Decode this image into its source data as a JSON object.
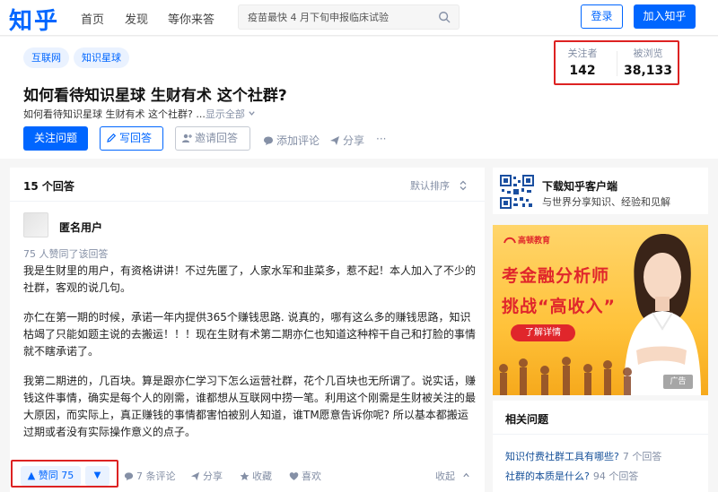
{
  "brand": {
    "logo_text": "知乎"
  },
  "nav": {
    "links": [
      "首页",
      "发现",
      "等你来答"
    ]
  },
  "search": {
    "placeholder": "疫苗最快 4 月下旬申报临床试验"
  },
  "auth": {
    "login": "登录",
    "join": "加入知乎"
  },
  "question": {
    "topics": [
      "互联网",
      "知识星球"
    ],
    "title": "如何看待知识星球 生财有术 这个社群?",
    "description": "如何看待知识星球 生财有术 这个社群? ...",
    "show_all": "显示全部",
    "stats": {
      "followers_label": "关注者",
      "followers": "142",
      "views_label": "被浏览",
      "views": "38,133"
    },
    "actions": {
      "follow": "关注问题",
      "write": "写回答",
      "invite": "邀请回答",
      "comment": "添加评论",
      "share": "分享",
      "more": "···"
    }
  },
  "answers": {
    "count_label": "15 个回答",
    "sort_label": "默认排序",
    "answer": {
      "author": "匿名用户",
      "likes_note": "75 人赞同了该回答",
      "paragraphs": [
        "我是生财里的用户，有资格讲讲！不过先匿了，人家水军和韭菜多，惹不起！本人加入了不少的社群，客观的说几句。",
        "亦仁在第一期的时候，承诺一年内提供365个赚钱思路. 说真的，哪有这么多的赚钱思路，知识枯竭了只能如题主说的去搬运！！！现在生财有术第二期亦仁也知道这种榨干自己和打脸的事情就不瞎承诺了。",
        "我第二期进的，几百块。算是跟亦仁学习下怎么运营社群，花个几百块也无所谓了。说实话，赚钱这件事情，确实是每个人的刚需，谁都想从互联网中捞一笔。利用这个刚需是生财被关注的最大原因，而实际上，真正赚钱的事情都害怕被别人知道，谁TM愿意告诉你呢? 所以基本都搬运过期或者没有实际操作意义的点子。"
      ],
      "footer": {
        "upvote": "▲ 赞同 75",
        "downvote": "▼",
        "comments": "7 条评论",
        "share": "分享",
        "favorite": "收藏",
        "like": "喜欢",
        "collapse": "收起"
      }
    }
  },
  "sidebar": {
    "app": {
      "title": "下载知乎客户端",
      "subtitle": "与世界分享知识、经验和见解"
    },
    "ad": {
      "brand": "高顿教育",
      "line1": "考金融分析师",
      "line2": "挑战“高收入”",
      "cta": "了解详情",
      "badge": "广告"
    },
    "related": {
      "title": "相关问题",
      "items": [
        {
          "text": "知识付费社群工具有哪些?",
          "count": "7 个回答"
        },
        {
          "text": "社群的本质是什么?",
          "count": "94 个回答"
        }
      ]
    }
  },
  "colors": {
    "brand": "#0066ff",
    "highlight_box": "#dd2222",
    "ad_red": "#e0262b",
    "muted": "#8590a6"
  }
}
